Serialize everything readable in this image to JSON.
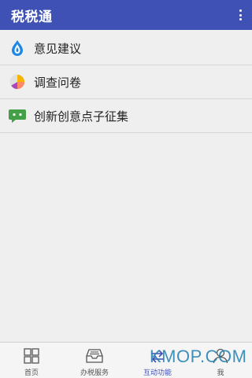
{
  "app": {
    "title": "税税通"
  },
  "menu": {
    "items": [
      {
        "label": "意见建议",
        "icon": "water-drop-icon"
      },
      {
        "label": "调查问卷",
        "icon": "pie-chart-icon"
      },
      {
        "label": "创新创意点子征集",
        "icon": "chat-bubble-icon"
      }
    ]
  },
  "bottom_nav": {
    "tabs": [
      {
        "label": "首页",
        "icon": "grid-icon"
      },
      {
        "label": "办税服务",
        "icon": "inbox-tray-icon"
      },
      {
        "label": "互动功能",
        "icon": "interaction-icon",
        "active": true
      },
      {
        "label": "我",
        "icon": "user-icon"
      }
    ]
  },
  "watermark": {
    "text": "KMOP.COM"
  },
  "colors": {
    "primary": "#3f51b5",
    "background": "#efefef"
  }
}
